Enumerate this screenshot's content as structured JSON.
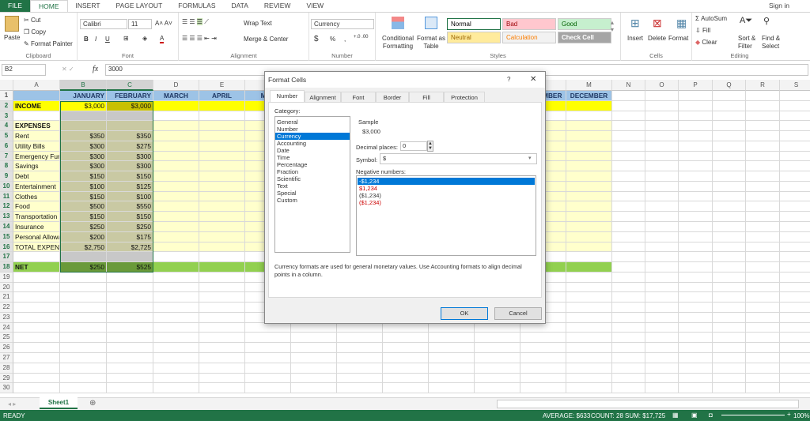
{
  "ribbon_tabs": [
    "FILE",
    "HOME",
    "INSERT",
    "PAGE LAYOUT",
    "FORMULAS",
    "DATA",
    "REVIEW",
    "VIEW"
  ],
  "sign_in": "Sign in",
  "clipboard": {
    "paste": "Paste",
    "cut": "Cut",
    "copy": "Copy",
    "format_painter": "Format Painter",
    "label": "Clipboard"
  },
  "font": {
    "name": "Calibri",
    "size": "11",
    "bold": "B",
    "italic": "I",
    "underline": "U",
    "label": "Font"
  },
  "alignment": {
    "wrap": "Wrap Text",
    "merge": "Merge & Center",
    "label": "Alignment"
  },
  "number": {
    "format": "Currency",
    "currency": "$",
    "percent": "%",
    "comma": ",",
    "label": "Number"
  },
  "styles": {
    "conditional": "Conditional Formatting",
    "format_table": "Format as Table",
    "cells": [
      {
        "label": "Normal",
        "bg": "#ffffff",
        "color": "#000000"
      },
      {
        "label": "Bad",
        "bg": "#ffc7ce",
        "color": "#9c0006"
      },
      {
        "label": "Good",
        "bg": "#c6efce",
        "color": "#006100"
      },
      {
        "label": "Neutral",
        "bg": "#ffeb9c",
        "color": "#9c6500"
      },
      {
        "label": "Calculation",
        "bg": "#f2f2f2",
        "color": "#fa7d00"
      },
      {
        "label": "Check Cell",
        "bg": "#a5a5a5",
        "color": "#ffffff"
      }
    ],
    "label": "Styles"
  },
  "cells_group": {
    "insert": "Insert",
    "delete": "Delete",
    "format": "Format",
    "label": "Cells"
  },
  "editing": {
    "autosum": "AutoSum",
    "fill": "Fill",
    "clear": "Clear",
    "sort": "Sort & Filter",
    "find": "Find & Select",
    "label": "Editing"
  },
  "formula_bar": {
    "name_box": "B2",
    "fx": "fx",
    "value": "3000"
  },
  "columns": [
    "A",
    "B",
    "C",
    "D",
    "E",
    "F",
    "G",
    "H",
    "I",
    "J",
    "K",
    "L",
    "M",
    "N",
    "O",
    "P",
    "Q",
    "R",
    "S"
  ],
  "rows": [
    [
      "",
      "JANUARY",
      "FEBRUARY",
      "MARCH",
      "APRIL",
      "MAY",
      "",
      "",
      "",
      "",
      "",
      "NOVEMBER",
      "DECEMBER"
    ],
    [
      "INCOME",
      "$3,000",
      "$3,000"
    ],
    [
      "",
      "",
      ""
    ],
    [
      "EXPENSES",
      "",
      ""
    ],
    [
      "Rent",
      "$350",
      "$350"
    ],
    [
      "Utility Bills",
      "$300",
      "$275"
    ],
    [
      "Emergency Fund",
      "$300",
      "$300"
    ],
    [
      "Savings",
      "$300",
      "$300"
    ],
    [
      "Debt",
      "$150",
      "$150"
    ],
    [
      "Entertainment",
      "$100",
      "$125"
    ],
    [
      "Clothes",
      "$150",
      "$100"
    ],
    [
      "Food",
      "$500",
      "$550"
    ],
    [
      "Transportation",
      "$150",
      "$150"
    ],
    [
      "Insurance",
      "$250",
      "$250"
    ],
    [
      "Personal Allowance",
      "$200",
      "$175"
    ],
    [
      "TOTAL EXPENSES",
      "$2,750",
      "$2,725"
    ],
    [
      "",
      "",
      ""
    ],
    [
      "NET",
      "$250",
      "$525"
    ]
  ],
  "row_count": 30,
  "sheet_tab": "Sheet1",
  "status": {
    "ready": "READY",
    "average": "AVERAGE: $633",
    "count": "COUNT: 28",
    "sum": "SUM: $17,725",
    "zoom": "100%"
  },
  "dialog": {
    "title": "Format Cells",
    "help": "?",
    "tabs": [
      "Number",
      "Alignment",
      "Font",
      "Border",
      "Fill",
      "Protection"
    ],
    "category_label": "Category:",
    "categories": [
      "General",
      "Number",
      "Currency",
      "Accounting",
      "Date",
      "Time",
      "Percentage",
      "Fraction",
      "Scientific",
      "Text",
      "Special",
      "Custom"
    ],
    "selected_category": "Currency",
    "sample_label": "Sample",
    "sample": "$3,000",
    "decimal_label": "Decimal places:",
    "decimal": "0",
    "symbol_label": "Symbol:",
    "symbol": "$",
    "negative_label": "Negative numbers:",
    "negatives": [
      {
        "t": "-$1,234",
        "red": false
      },
      {
        "t": "$1,234",
        "red": true
      },
      {
        "t": "($1,234)",
        "red": false
      },
      {
        "t": "($1,234)",
        "red": true
      }
    ],
    "description": "Currency formats are used for general monetary values.  Use Accounting formats to align decimal points in a column.",
    "ok": "OK",
    "cancel": "Cancel"
  },
  "colors": {
    "accent": "#217346",
    "header_blue": "#9dc3e6",
    "income_yellow": "#ffff00",
    "body_yellow": "#ffffcc",
    "net_green": "#92d050",
    "select_blue": "#0078d7"
  }
}
